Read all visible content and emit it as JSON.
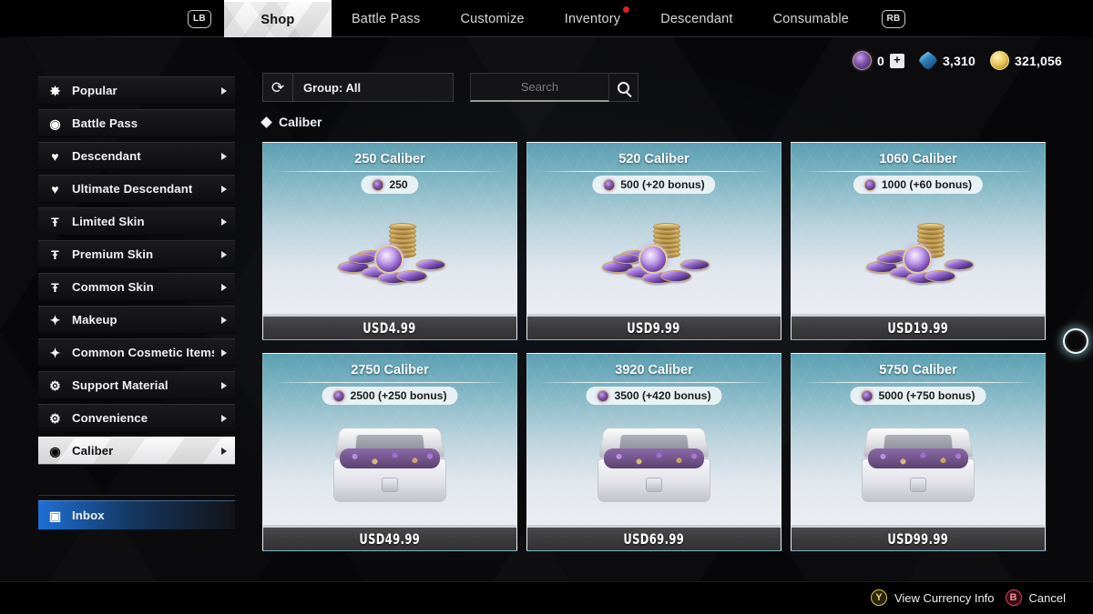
{
  "topnav": {
    "left_bumper": "LB",
    "right_bumper": "RB",
    "tabs": [
      {
        "label": "Shop",
        "active": true,
        "dot": false
      },
      {
        "label": "Battle Pass",
        "active": false,
        "dot": false
      },
      {
        "label": "Customize",
        "active": false,
        "dot": false
      },
      {
        "label": "Inventory",
        "active": false,
        "dot": true
      },
      {
        "label": "Descendant",
        "active": false,
        "dot": false
      },
      {
        "label": "Consumable",
        "active": false,
        "dot": false
      }
    ]
  },
  "currency": [
    {
      "icon": "caliber-coin-icon",
      "value": "0",
      "has_plus": true,
      "plus_label": "+"
    },
    {
      "icon": "crystal-icon",
      "value": "3,310",
      "has_plus": false
    },
    {
      "icon": "gold-coin-icon",
      "value": "321,056",
      "has_plus": false
    }
  ],
  "sidebar": {
    "items": [
      {
        "label": "Popular",
        "icon": "star-burst-icon",
        "glyph": "✸",
        "arrow": true,
        "selected": false
      },
      {
        "label": "Battle Pass",
        "icon": "battlepass-emblem-icon",
        "glyph": "◉",
        "arrow": false,
        "selected": false
      },
      {
        "label": "Descendant",
        "icon": "descendant-crest-icon",
        "glyph": "♥",
        "arrow": true,
        "selected": false
      },
      {
        "label": "Ultimate Descendant",
        "icon": "ultimate-descendant-crest-icon",
        "glyph": "♥",
        "arrow": true,
        "selected": false
      },
      {
        "label": "Limited Skin",
        "icon": "shirt-icon",
        "glyph": "Ŧ",
        "arrow": true,
        "selected": false
      },
      {
        "label": "Premium Skin",
        "icon": "shirt-icon",
        "glyph": "Ŧ",
        "arrow": true,
        "selected": false
      },
      {
        "label": "Common Skin",
        "icon": "shirt-icon",
        "glyph": "Ŧ",
        "arrow": true,
        "selected": false
      },
      {
        "label": "Makeup",
        "icon": "magic-wand-icon",
        "glyph": "✦",
        "arrow": true,
        "selected": false
      },
      {
        "label": "Common Cosmetic Items/Atta",
        "icon": "magic-wand-icon",
        "glyph": "✦",
        "arrow": true,
        "selected": false
      },
      {
        "label": "Support Material",
        "icon": "upgrade-module-icon",
        "glyph": "⚙",
        "arrow": true,
        "selected": false
      },
      {
        "label": "Convenience",
        "icon": "upgrade-module-icon",
        "glyph": "⚙",
        "arrow": true,
        "selected": false
      },
      {
        "label": "Caliber",
        "icon": "caliber-shield-icon",
        "glyph": "◉",
        "arrow": true,
        "selected": true
      }
    ],
    "inbox": {
      "label": "Inbox",
      "icon": "inbox-window-icon",
      "glyph": "▣"
    }
  },
  "controls": {
    "refresh_icon": "refresh-icon",
    "group_label": "Group: All",
    "search_placeholder": "Search",
    "search_value": "",
    "search_icon": "magnifier-icon"
  },
  "section": {
    "bullet_icon": "diamond-bullet-icon",
    "title": "Caliber"
  },
  "products": [
    {
      "title": "250 Caliber",
      "amount": "250",
      "price": "USD4.99",
      "art": "coins"
    },
    {
      "title": "520 Caliber",
      "amount": "500 (+20 bonus)",
      "price": "USD9.99",
      "art": "coins"
    },
    {
      "title": "1060 Caliber",
      "amount": "1000 (+60 bonus)",
      "price": "USD19.99",
      "art": "coins"
    },
    {
      "title": "2750 Caliber",
      "amount": "2500 (+250 bonus)",
      "price": "USD49.99",
      "art": "chest"
    },
    {
      "title": "3920 Caliber",
      "amount": "3500 (+420 bonus)",
      "price": "USD69.99",
      "art": "chest"
    },
    {
      "title": "5750 Caliber",
      "amount": "5000 (+750 bonus)",
      "price": "USD99.99",
      "art": "chest"
    }
  ],
  "footer": {
    "hints": [
      {
        "button": "Y",
        "label": "View Currency Info",
        "color": "#d8c845"
      },
      {
        "button": "B",
        "label": "Cancel",
        "color": "#d3455c"
      }
    ]
  },
  "colors": {
    "accent_blue": "#1f6fd6",
    "card_top": "#5c9fb2",
    "card_bottom": "#eef0f4",
    "caliber_purple": "#7a4fa8",
    "gold": "#e8c75a",
    "notification_red": "#e01f1f"
  }
}
